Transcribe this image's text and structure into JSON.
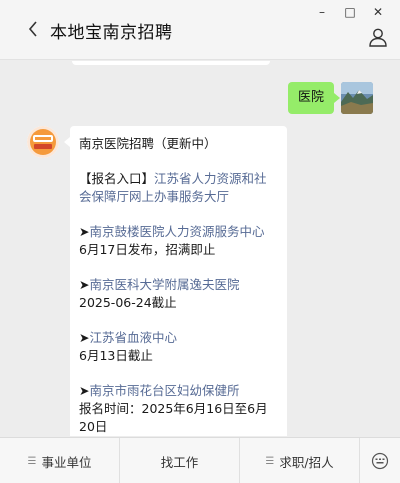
{
  "window": {
    "title": "本地宝南京招聘",
    "controls": [
      "–",
      "□",
      "✕"
    ]
  },
  "icons": {
    "back": "chevron-left-icon",
    "user": "person-icon",
    "keyboard": "keyboard-icon"
  },
  "user_message": {
    "text": "医院"
  },
  "bot_message": {
    "heading": "南京医院招聘（更新中）",
    "entry_prefix": "【报名入口】",
    "entry_link": "江苏省人力资源和社会保障厅网上办事服务大厅",
    "items": [
      {
        "arrow": "➤",
        "link": "南京鼓楼医院人力资源服务中心",
        "note": "6月17日发布，招满即止"
      },
      {
        "arrow": "➤",
        "link": "南京医科大学附属逸夫医院",
        "note": "2025-06-24截止"
      },
      {
        "arrow": "➤",
        "link": "江苏省血液中心",
        "note": "6月13日截止"
      },
      {
        "arrow": "➤",
        "link": "南京市雨花台区妇幼保健所",
        "note": "报名时间：2025年6月16日至6月20日"
      }
    ]
  },
  "bottom_menu": [
    {
      "label": "事业单位"
    },
    {
      "label": "找工作"
    },
    {
      "label": "求职/招人"
    }
  ],
  "colors": {
    "user_bubble": "#95ec69",
    "link": "#576b95",
    "background": "#ededed"
  }
}
